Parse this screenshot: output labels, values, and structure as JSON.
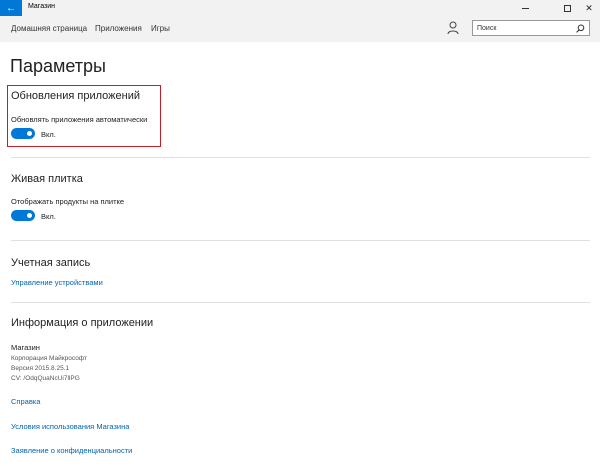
{
  "window": {
    "title": "Магазин",
    "back_glyph": "←",
    "close_glyph": "✕"
  },
  "nav": {
    "items": [
      {
        "label": "Домашняя страница"
      },
      {
        "label": "Приложения"
      },
      {
        "label": "Игры"
      }
    ],
    "search": {
      "placeholder": "Поиск",
      "value": ""
    }
  },
  "page": {
    "title": "Параметры"
  },
  "sections": {
    "updates": {
      "title": "Обновления приложений",
      "setting_label": "Обновлять приложения автоматически",
      "toggle_state": "Вкл."
    },
    "live_tile": {
      "title": "Живая плитка",
      "setting_label": "Отображать продукты на плитке",
      "toggle_state": "Вкл."
    },
    "account": {
      "title": "Учетная запись",
      "link": "Управление устройствами"
    },
    "app_info": {
      "title": "Информация о приложении",
      "app_name": "Магазин",
      "publisher": "Корпорация Майкрософт",
      "version": "Версия 2015.8.25.1",
      "cv": "CV: /OdqQuaNcUi7llPG",
      "links": [
        "Справка",
        "Условия использования Магазина",
        "Заявление о конфиденциальности"
      ]
    }
  },
  "colors": {
    "accent": "#0078d7",
    "link": "#0063b1",
    "highlight": "#c0202a",
    "chrome_bg": "#f2f2f2"
  },
  "icons": {
    "back": "arrow-left-icon",
    "user": "user-icon",
    "search": "search-icon"
  }
}
